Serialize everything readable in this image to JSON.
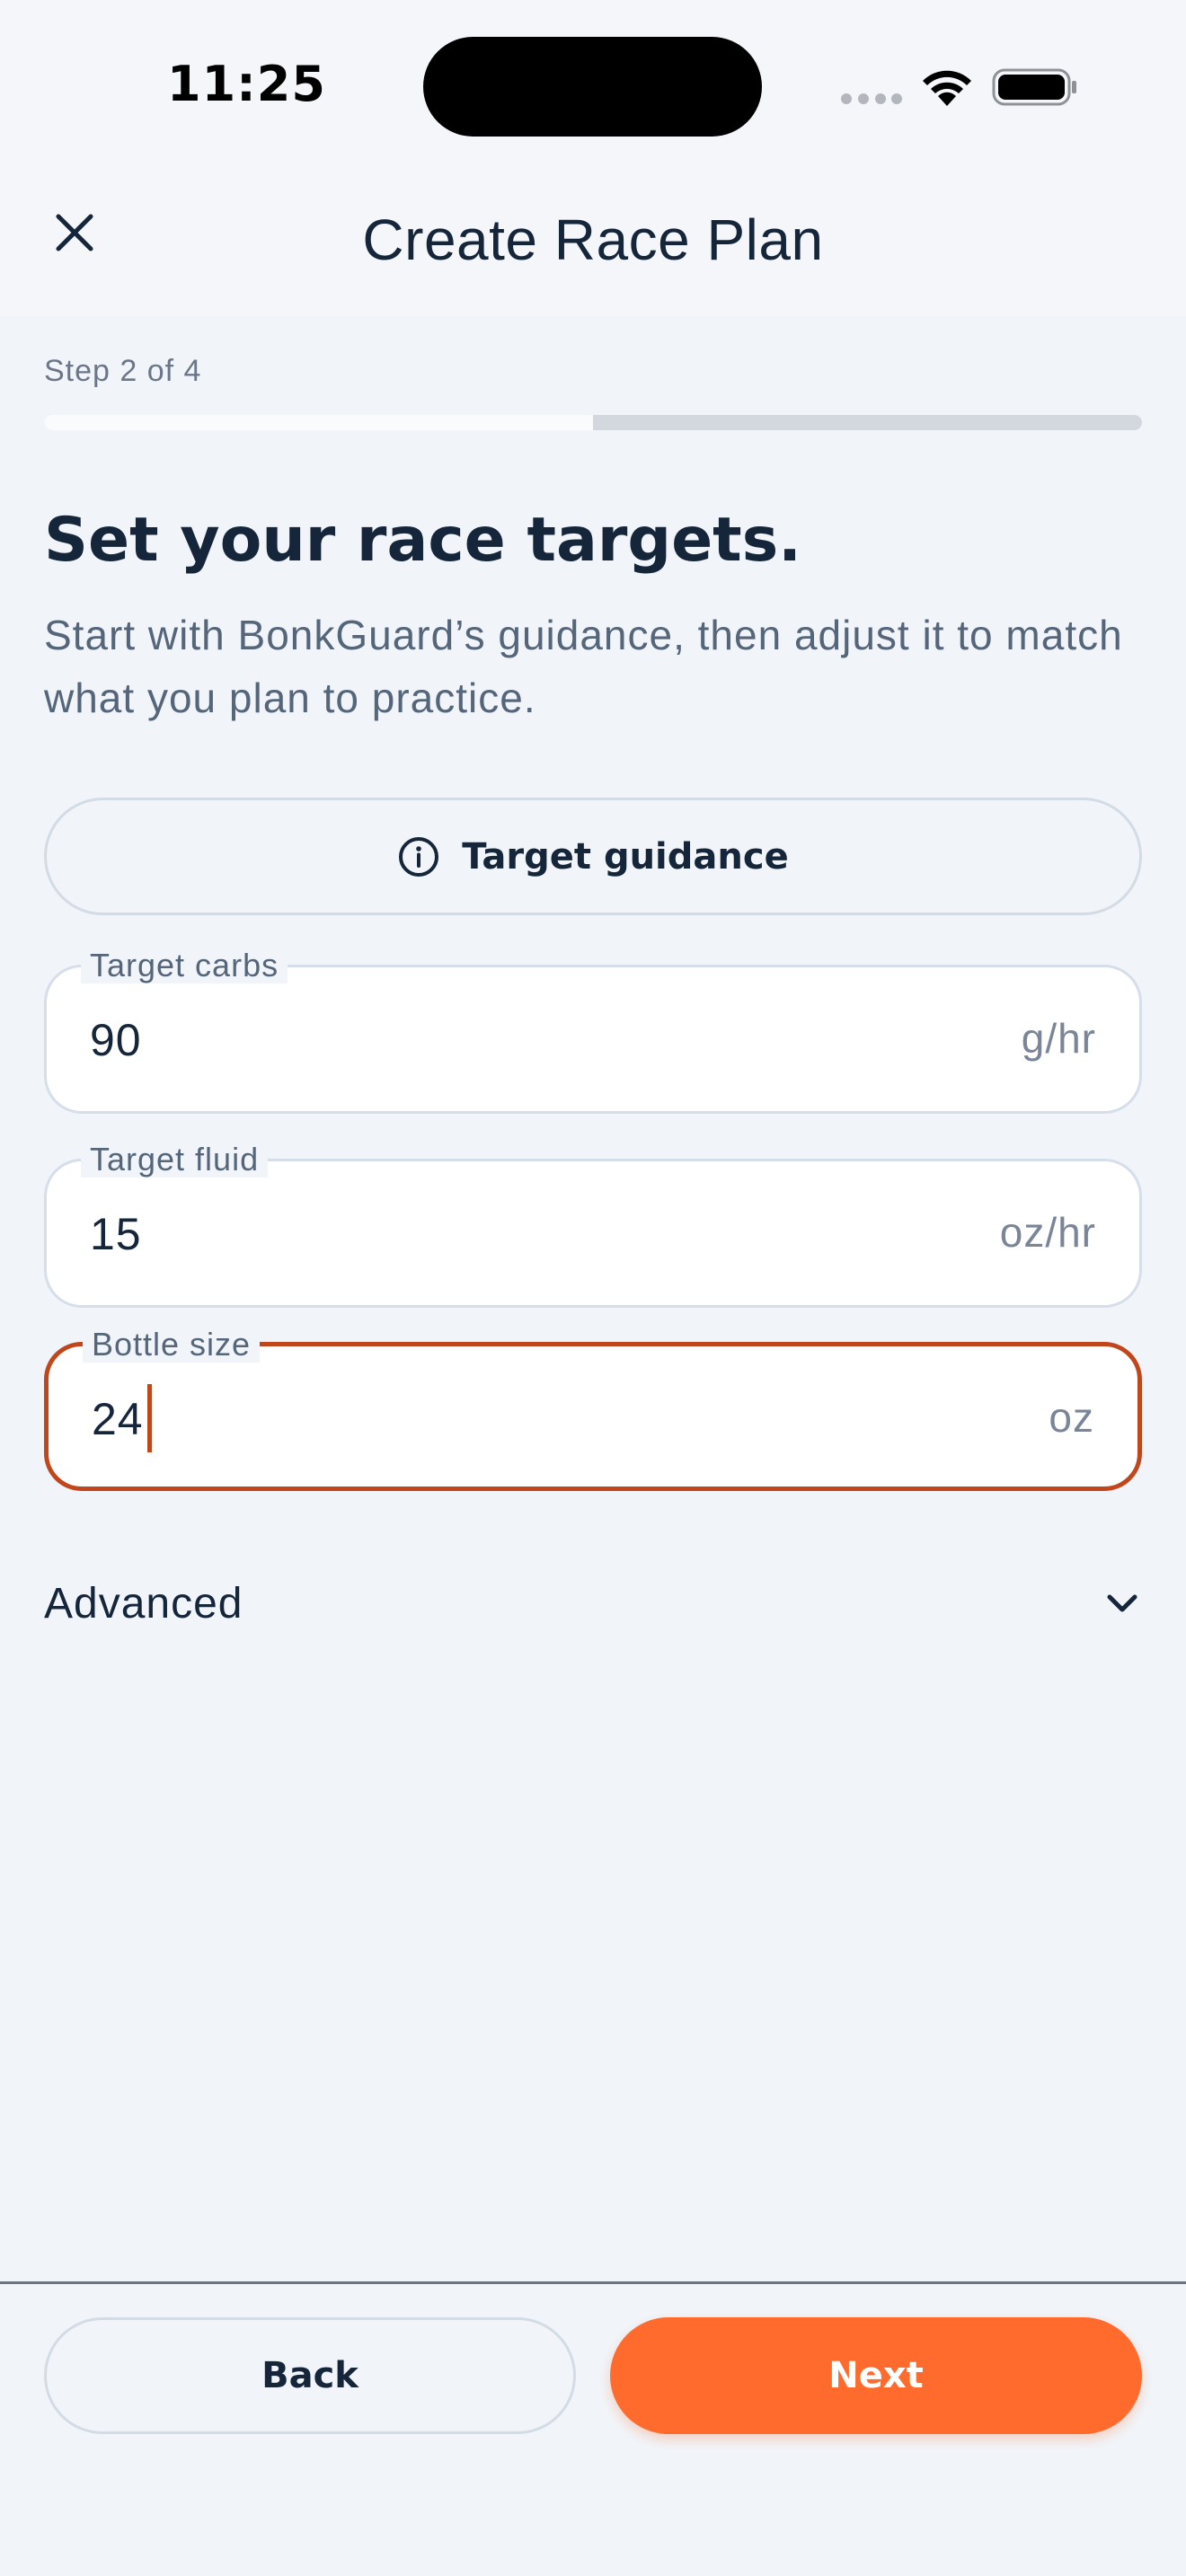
{
  "status_bar": {
    "time": "11:25",
    "wifi_icon": "wifi-icon",
    "battery_icon": "battery-full-icon"
  },
  "header": {
    "title": "Create Race Plan",
    "close_icon": "close-icon"
  },
  "progress": {
    "step_label": "Step 2 of 4",
    "current_step": 2,
    "total_steps": 4,
    "fraction": 0.5
  },
  "intro": {
    "headline": "Set your race targets.",
    "subtitle": "Start with BonkGuard’s guidance, then adjust it to match what you plan to practice."
  },
  "guidance_button": {
    "label": "Target guidance",
    "icon": "info-icon"
  },
  "fields": {
    "target_carbs": {
      "label": "Target carbs",
      "value": "90",
      "unit": "g/hr"
    },
    "target_fluid": {
      "label": "Target fluid",
      "value": "15",
      "unit": "oz/hr"
    },
    "bottle_size": {
      "label": "Bottle size",
      "value": "24",
      "unit": "oz",
      "focused": true
    }
  },
  "advanced": {
    "label": "Advanced",
    "icon": "chevron-down-icon"
  },
  "footer": {
    "back_label": "Back",
    "next_label": "Next"
  },
  "colors": {
    "accent": "#ff6b2c",
    "focus_border": "#c0461c",
    "text_primary": "#15253a",
    "background": "#f1f5fa"
  }
}
